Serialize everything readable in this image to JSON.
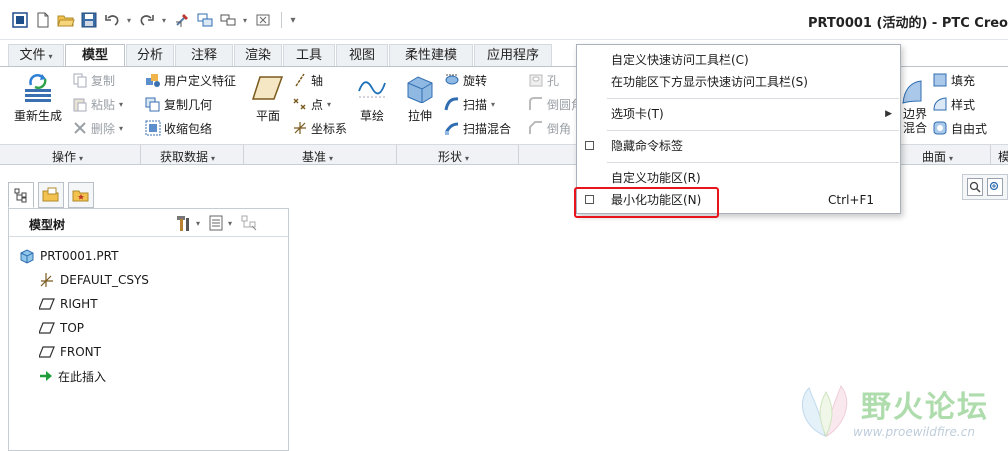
{
  "window": {
    "title": "PRT0001 (活动的) - PTC Creo"
  },
  "ribbon": {
    "tabs": [
      {
        "label": "文件",
        "caret": "▾"
      },
      {
        "label": "模型"
      },
      {
        "label": "分析"
      },
      {
        "label": "注释"
      },
      {
        "label": "渲染"
      },
      {
        "label": "工具"
      },
      {
        "label": "视图"
      },
      {
        "label": "柔性建模"
      },
      {
        "label": "应用程序"
      }
    ],
    "groups": {
      "operations": {
        "label": "操作",
        "regenerate": "重新生成",
        "copy": "复制",
        "paste": "粘贴",
        "delete": "删除"
      },
      "get_data": {
        "label": "获取数据",
        "udf": "用户定义特征",
        "copy_geom": "复制几何",
        "shrinkwrap": "收缩包络"
      },
      "datum": {
        "label": "基准",
        "plane": "平面",
        "axis": "轴",
        "point": "点",
        "csys": "坐标系",
        "sketch": "草绘"
      },
      "shapes": {
        "label": "形状",
        "extrude": "拉伸",
        "revolve": "旋转",
        "sweep": "扫描",
        "swept_blend": "扫描混合"
      },
      "engineering": {
        "hole": "孔",
        "round": "倒圆角",
        "chamfer": "倒角"
      },
      "surfaces": {
        "label": "曲面",
        "boundary": "边界\n混合",
        "fill": "填充",
        "style": "样式",
        "freestyle": "自由式"
      },
      "model_intent_partial": "模"
    }
  },
  "context_menu": {
    "items": [
      {
        "label": "自定义快速访问工具栏(C)"
      },
      {
        "label": "在功能区下方显示快速访问工具栏(S)"
      },
      {
        "label": "选项卡(T)",
        "arrow": "▶"
      },
      {
        "label": "隐藏命令标签"
      },
      {
        "label": "自定义功能区(R)"
      },
      {
        "label": "最小化功能区(N)",
        "shortcut": "Ctrl+F1"
      }
    ]
  },
  "model_tree": {
    "title": "模型树",
    "items": [
      {
        "label": "PRT0001.PRT",
        "icon": "part-icon"
      },
      {
        "label": "DEFAULT_CSYS",
        "icon": "csys-icon"
      },
      {
        "label": "RIGHT",
        "icon": "datum-plane-icon"
      },
      {
        "label": "TOP",
        "icon": "datum-plane-icon"
      },
      {
        "label": "FRONT",
        "icon": "datum-plane-icon"
      },
      {
        "label": "在此插入",
        "icon": "insert-arrow-icon"
      }
    ]
  },
  "watermark": {
    "name": "野火论坛",
    "url": "www.proewildfire.cn"
  },
  "colors": {
    "highlight_box": "#e8141b",
    "ribbon_group_bar": "#f0f2f5",
    "watermark_green": "#6cc06a"
  }
}
